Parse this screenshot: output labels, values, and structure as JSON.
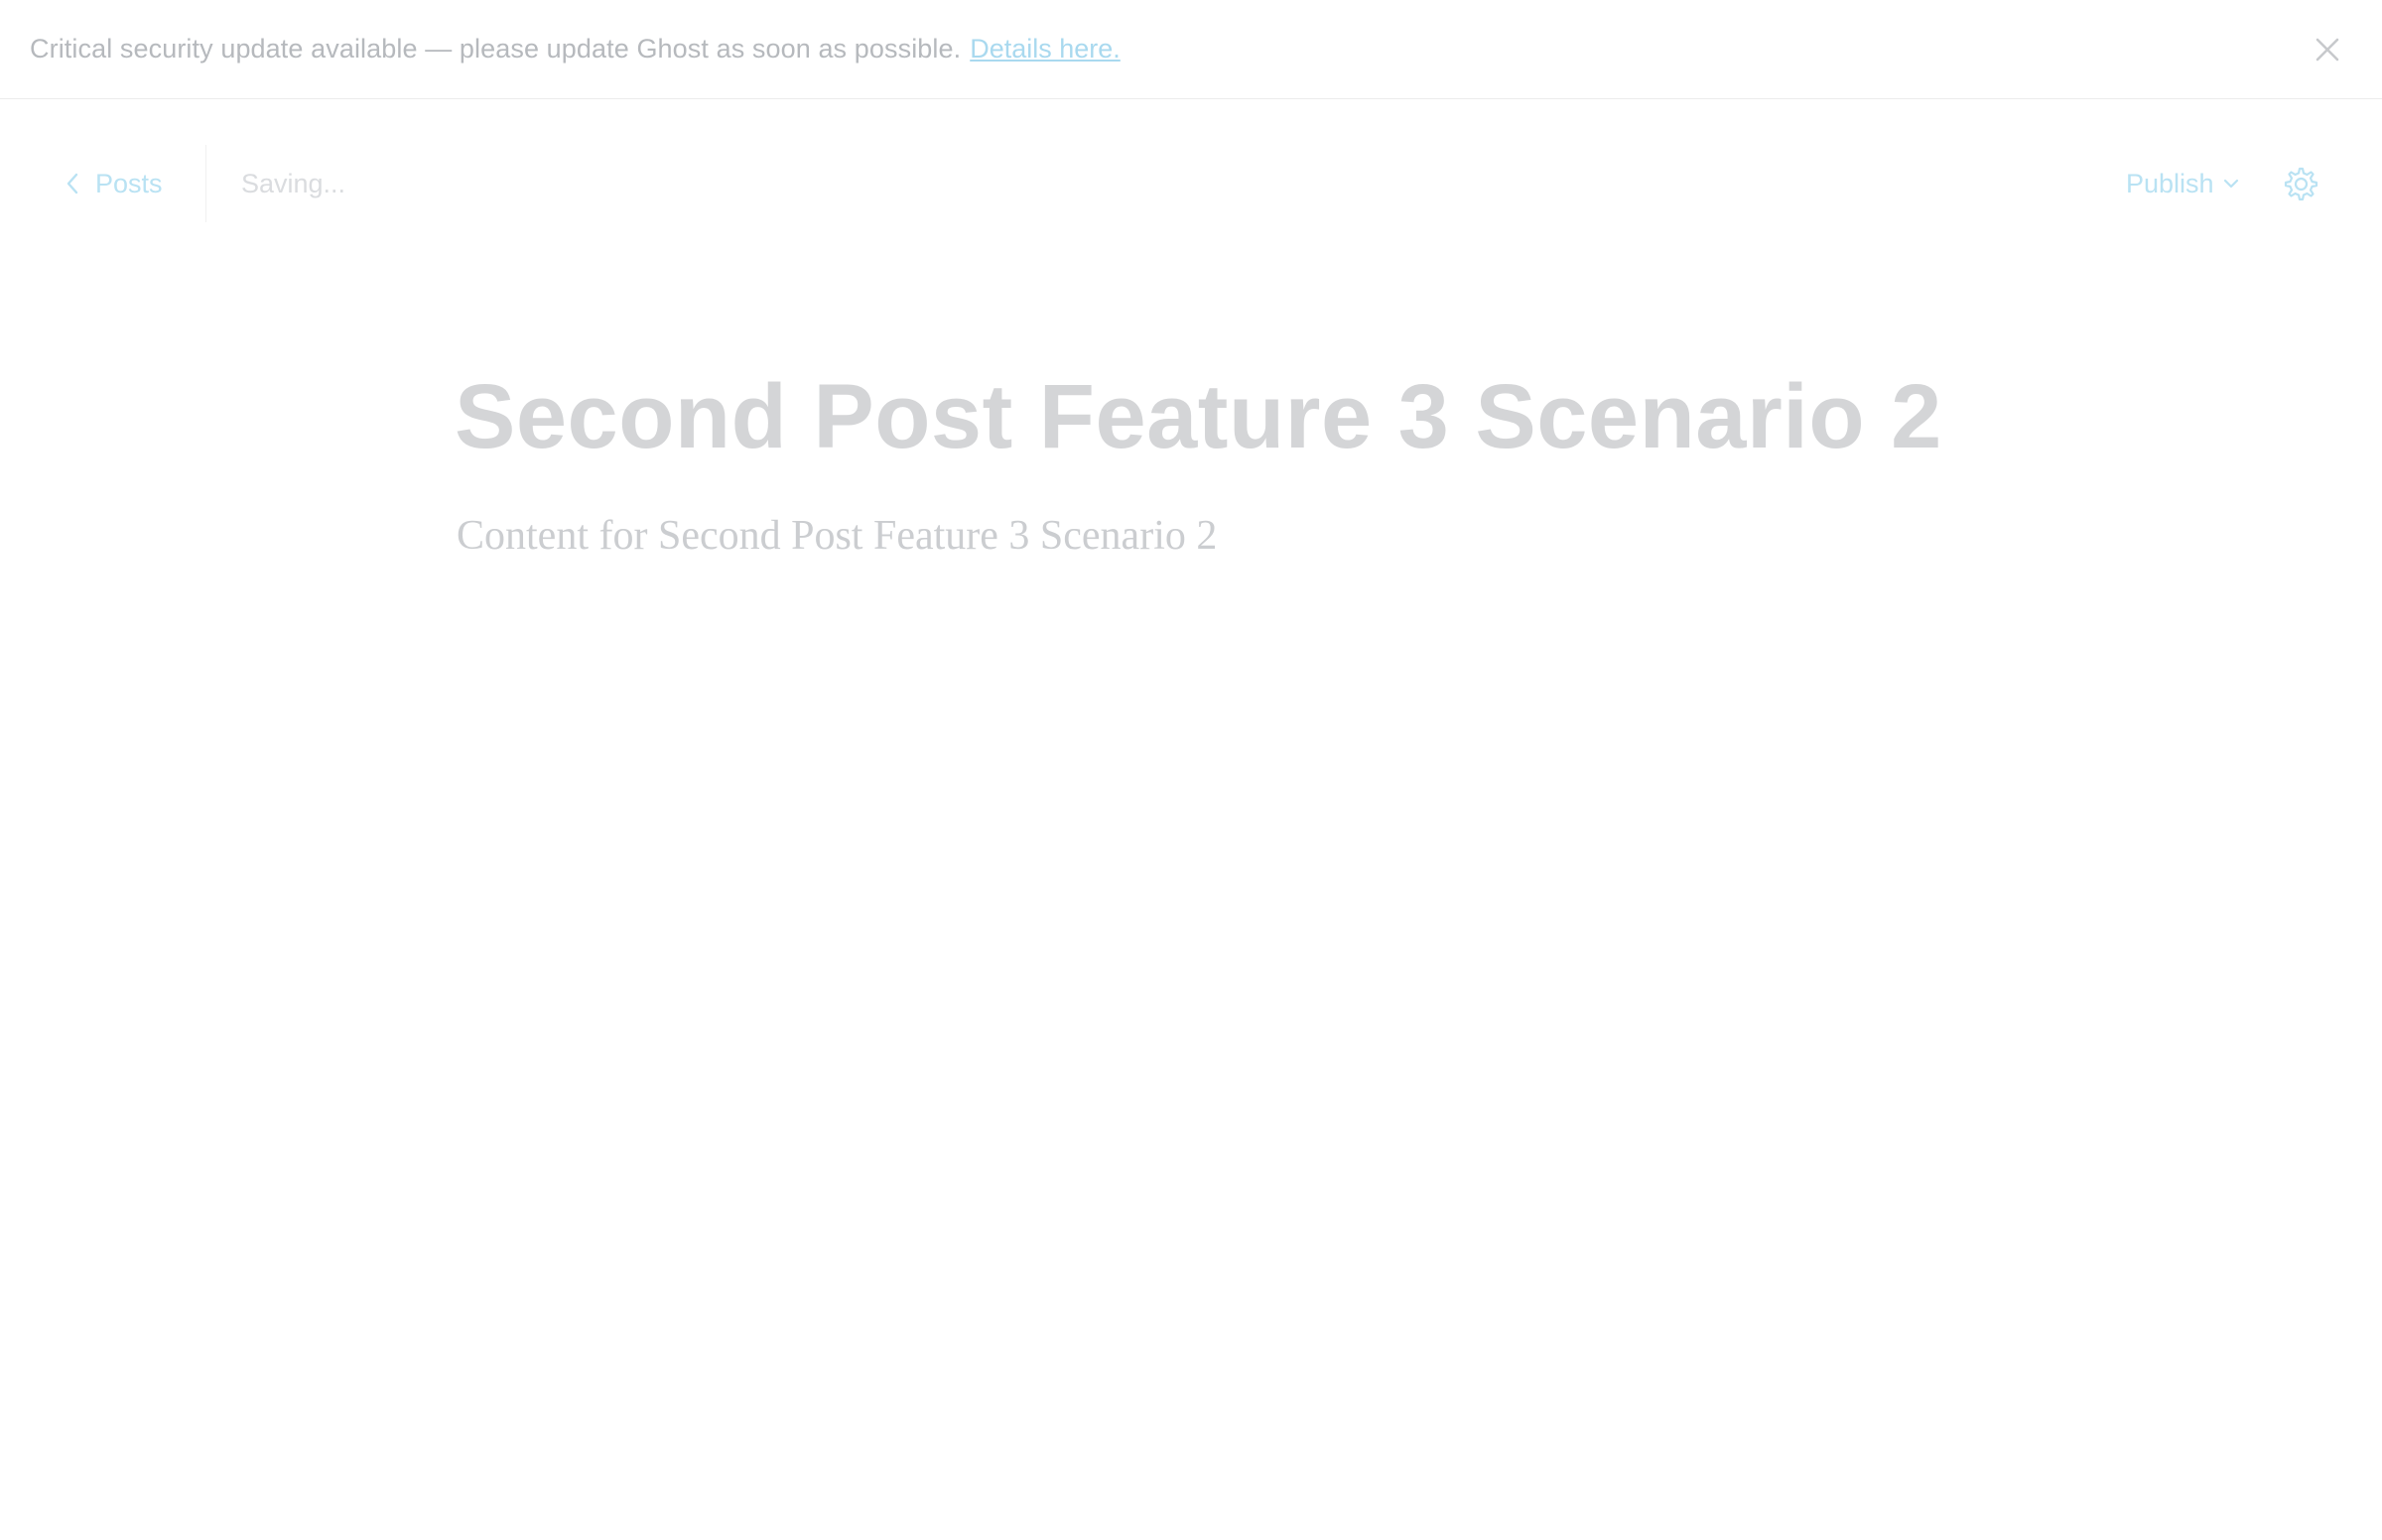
{
  "banner": {
    "message": "Critical security update available — please update Ghost as soon as possible.",
    "link_label": "Details here.",
    "close_icon": "close-icon"
  },
  "header": {
    "back_label": "Posts",
    "back_icon": "chevron-left-icon",
    "save_status": "Saving...",
    "publish_label": "Publish",
    "publish_icon": "chevron-down-icon",
    "settings_icon": "gear-icon"
  },
  "post": {
    "title": "Second Post Feature 3 Scenario 2",
    "body": "Content for Second Post Feature 3 Scenario 2"
  },
  "colors": {
    "accent": "#b9e2f3",
    "banner_text": "#b6b9bd",
    "title_text": "#d4d5d7"
  }
}
